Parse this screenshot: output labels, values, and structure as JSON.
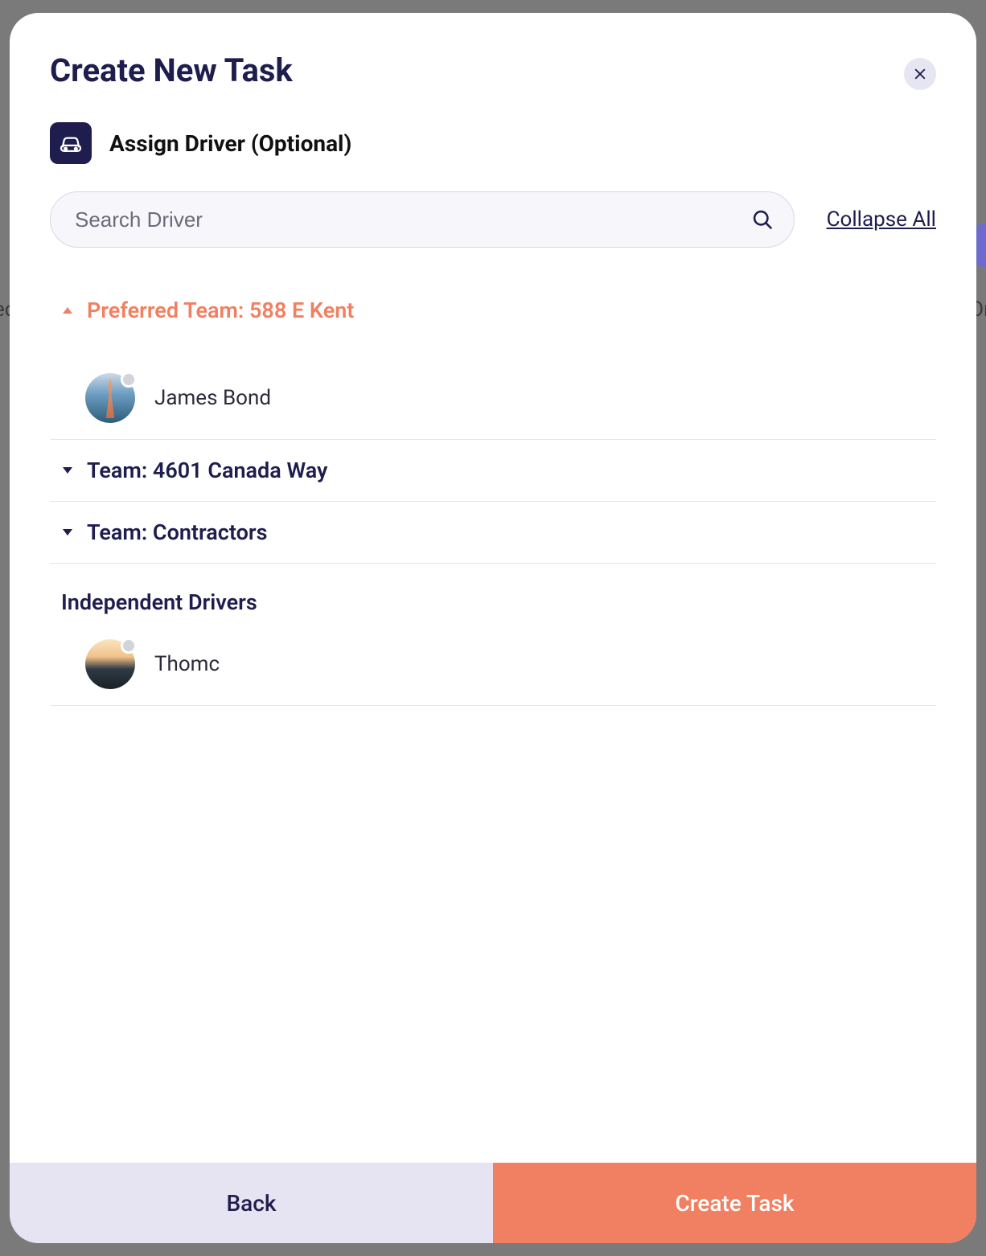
{
  "colors": {
    "accent": "#f08061",
    "navy": "#1f1d4d",
    "lavender": "#e6e3f3"
  },
  "modal": {
    "title": "Create New Task",
    "section_title": "Assign Driver (Optional)"
  },
  "search": {
    "placeholder": "Search Driver"
  },
  "actions": {
    "collapse_all": "Collapse All",
    "back": "Back",
    "create": "Create Task"
  },
  "teams": [
    {
      "label": "Preferred Team: 588 E Kent",
      "preferred": true,
      "expanded": true,
      "drivers": [
        {
          "name": "James Bond"
        }
      ]
    },
    {
      "label": "Team: 4601 Canada Way",
      "preferred": false,
      "expanded": false,
      "drivers": []
    },
    {
      "label": "Team: Contractors",
      "preferred": false,
      "expanded": false,
      "drivers": []
    }
  ],
  "independent": {
    "label": "Independent Drivers",
    "drivers": [
      {
        "name": "Thomc"
      }
    ]
  }
}
